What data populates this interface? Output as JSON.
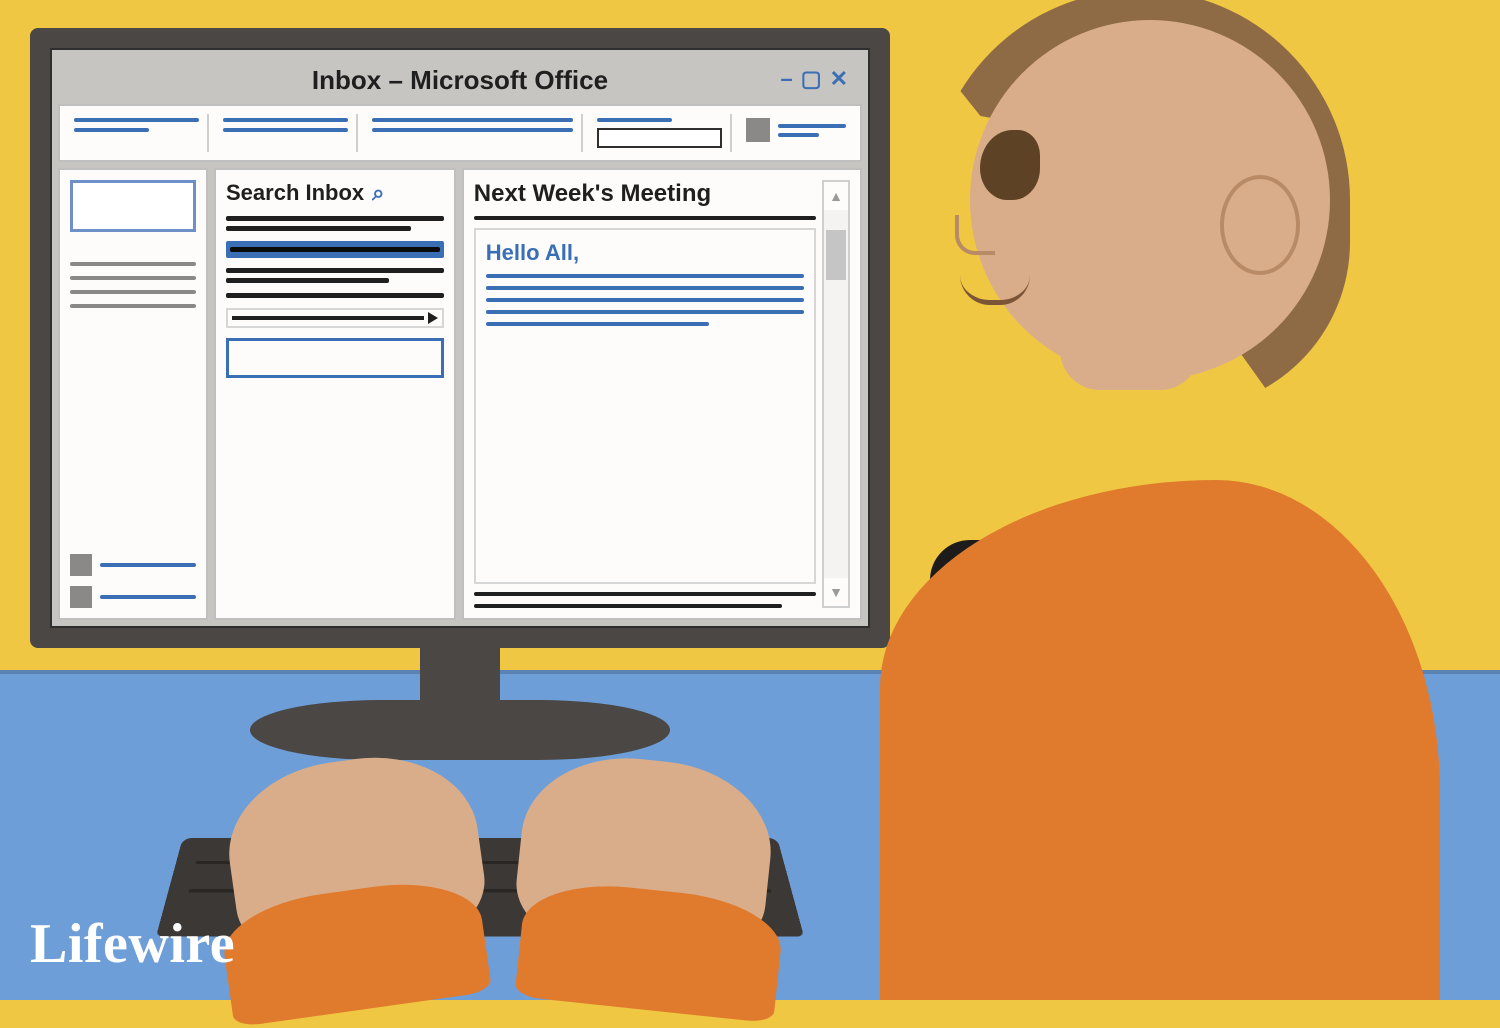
{
  "window": {
    "title": "Inbox – Microsoft Office"
  },
  "search": {
    "label": "Search Inbox"
  },
  "message": {
    "subject": "Next Week's Meeting",
    "greeting": "Hello All,"
  },
  "branding": {
    "logo_text": "Lifewire"
  }
}
